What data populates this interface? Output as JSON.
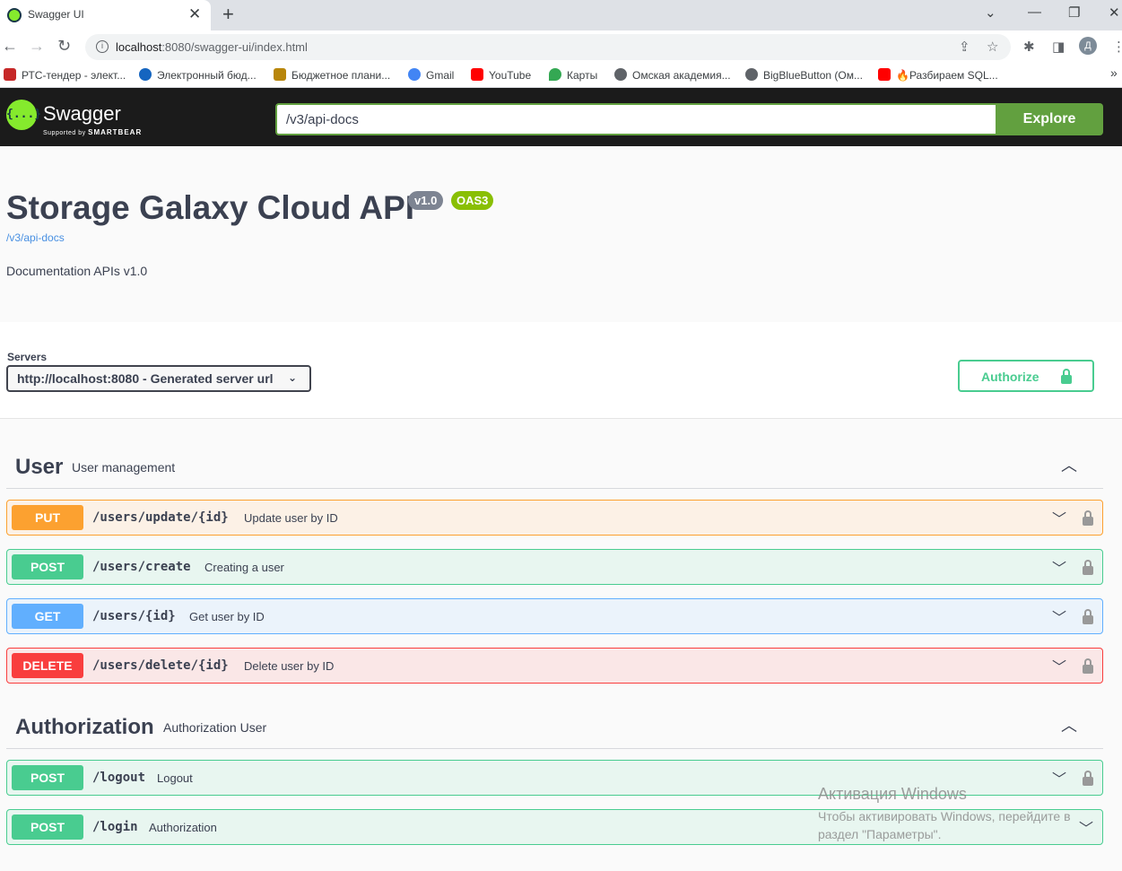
{
  "browser": {
    "tab_title": "Swagger UI",
    "url_host": "localhost",
    "url_rest": ":8080/swagger-ui/index.html",
    "profile_initial": "Д",
    "bookmarks": [
      {
        "label": "РТС-тендер - элект...",
        "icon": "rts-icon",
        "color": "#c62828"
      },
      {
        "label": "Электронный бюд...",
        "icon": "budget-icon",
        "color": "#1565c0"
      },
      {
        "label": "Бюджетное плани...",
        "icon": "emblem-icon",
        "color": "#b8860b"
      },
      {
        "label": "Gmail",
        "icon": "google-icon",
        "color": "#4285f4"
      },
      {
        "label": "YouTube",
        "icon": "youtube-icon",
        "color": "#ff0000"
      },
      {
        "label": "Карты",
        "icon": "maps-icon",
        "color": "#34a853"
      },
      {
        "label": "Омская академия...",
        "icon": "globe-icon",
        "color": "#5f6368"
      },
      {
        "label": "BigBlueButton (Ом...",
        "icon": "globe-icon",
        "color": "#5f6368"
      },
      {
        "label": "🔥Разбираем SQL...",
        "icon": "youtube-icon",
        "color": "#ff0000"
      }
    ]
  },
  "swagger": {
    "logo_text": "{...}",
    "brand": "Swagger",
    "supported_by": "Supported by",
    "smartbear": "SMARTBEAR",
    "spec_url": "/v3/api-docs",
    "explore_label": "Explore"
  },
  "info": {
    "title": "Storage Galaxy Cloud API",
    "version_badge": "v1.0",
    "oas_badge": "OAS3",
    "spec_link": "/v3/api-docs",
    "description": "Documentation APIs v1.0"
  },
  "servers": {
    "label": "Servers",
    "selected": "http://localhost:8080 - Generated server url",
    "authorize_label": "Authorize"
  },
  "tags": [
    {
      "name": "User",
      "description": "User management",
      "operations": [
        {
          "method": "PUT",
          "path": "/users/update/{id}",
          "summary": "Update user by ID"
        },
        {
          "method": "POST",
          "path": "/users/create",
          "summary": "Creating a user"
        },
        {
          "method": "GET",
          "path": "/users/{id}",
          "summary": "Get user by ID"
        },
        {
          "method": "DELETE",
          "path": "/users/delete/{id}",
          "summary": "Delete user by ID"
        }
      ]
    },
    {
      "name": "Authorization",
      "description": "Authorization User",
      "operations": [
        {
          "method": "POST",
          "path": "/logout",
          "summary": "Logout"
        },
        {
          "method": "POST",
          "path": "/login",
          "summary": "Authorization"
        }
      ]
    }
  ],
  "watermark": {
    "line1": "Активация Windows",
    "line2": "Чтобы активировать Windows, перейдите в",
    "line3": "раздел \"Параметры\"."
  },
  "colors": {
    "put": "#fca130",
    "post": "#49cc90",
    "get": "#61affe",
    "delete": "#f93e3e",
    "explore": "#62a03f"
  }
}
